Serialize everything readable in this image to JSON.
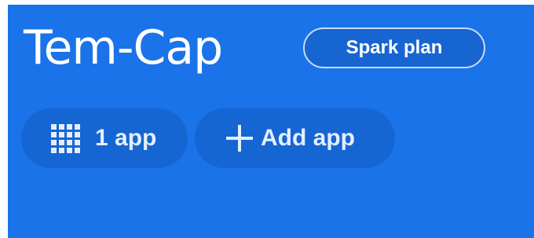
{
  "project": {
    "title": "Tem-Cap",
    "plan_label": "Spark plan"
  },
  "actions": {
    "apps_count_label": "1 app",
    "apps_icon": "grid-icon",
    "add_app_label": "Add app",
    "add_app_icon": "plus-icon"
  },
  "colors": {
    "background": "#1a73e8",
    "chip": "#1565d3",
    "text": "#ffffff"
  }
}
